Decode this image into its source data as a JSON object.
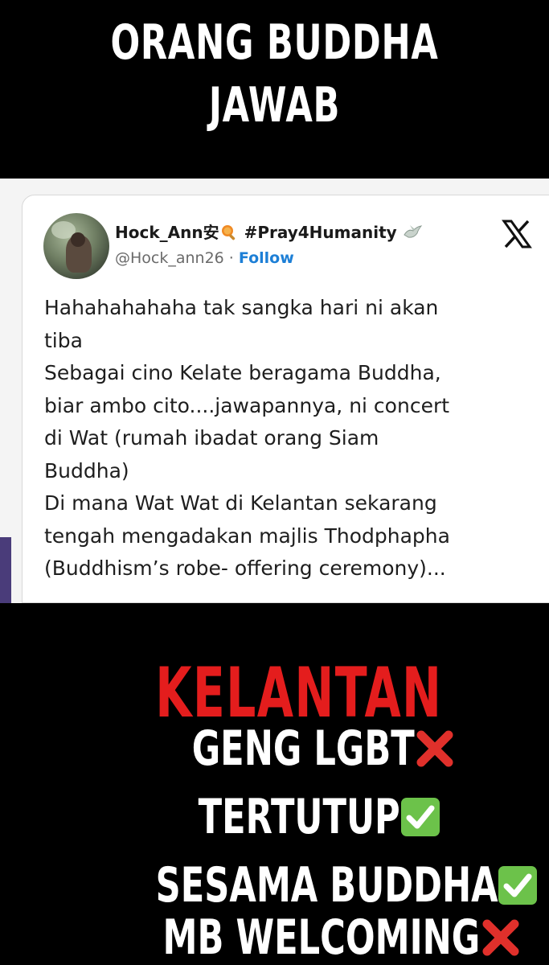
{
  "header": {
    "line1": "ORANG BUDDHA",
    "line2": "JAWAB"
  },
  "tweet": {
    "name": "Hock_Ann安",
    "hashtag": "#Pray4Humanity",
    "handle": "@Hock_ann26",
    "separator": " · ",
    "follow_label": "Follow",
    "platform_icon": "x-logo-icon",
    "lines": [
      "Hahahahahaha tak sangka hari ni akan",
      "tiba",
      "Sebagai cino Kelate beragama Buddha,",
      "biar ambo cito....jawapannya, ni concert",
      "di Wat (rumah ibadat orang Siam",
      "Buddha)",
      "Di mana Wat Wat di Kelantan sekarang",
      "tengah mengadakan majlis Thodphapha",
      "(Buddhism’s robe- offering ceremony)..."
    ]
  },
  "footer": {
    "title": "KELANTAN",
    "title_color": "#e41d1d",
    "items": [
      {
        "label": "GENG LGBT",
        "mark": "cross-mark-icon"
      },
      {
        "label": "TERTUTUP",
        "mark": "check-mark-icon"
      },
      {
        "label": "SESAMA BUDDHA",
        "mark": "check-mark-icon"
      },
      {
        "label": "MB WELCOMING",
        "mark": "cross-mark-icon"
      }
    ]
  },
  "colors": {
    "cross": "#e0302b",
    "check": "#6cc24a",
    "follow": "#1d7fd6"
  }
}
